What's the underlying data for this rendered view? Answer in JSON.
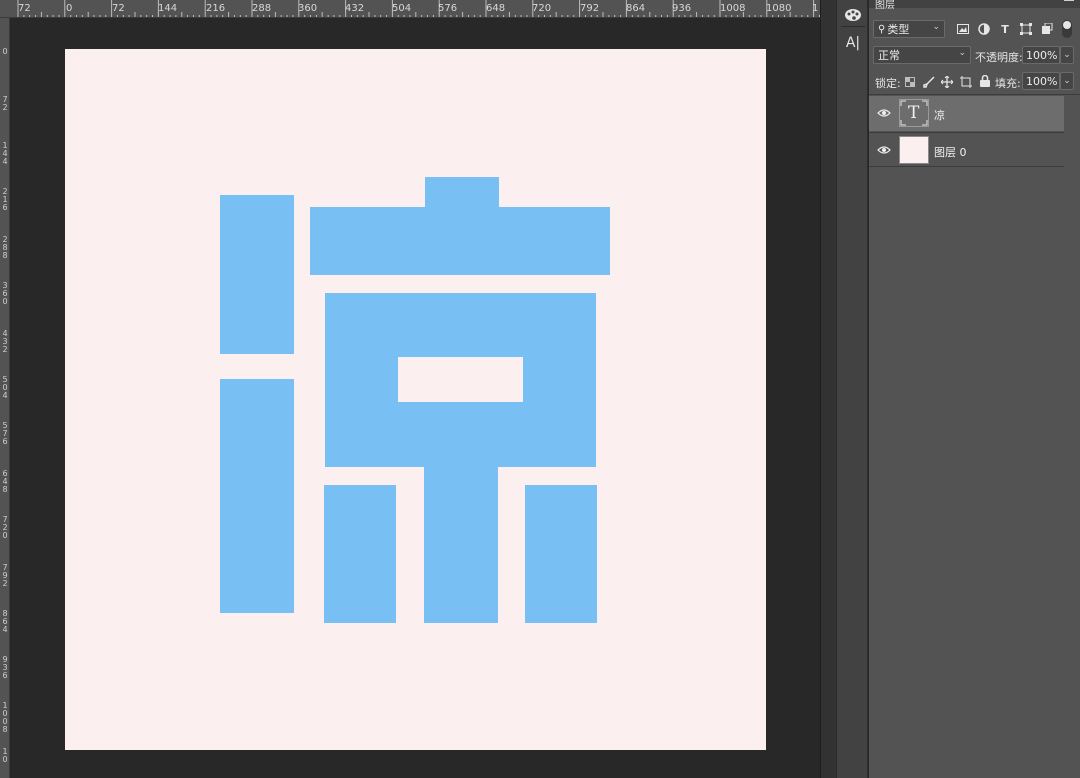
{
  "ruler": {
    "top_labels": [
      "72",
      "0",
      "72",
      "144",
      "216",
      "288",
      "360",
      "432",
      "504",
      "576",
      "648",
      "720",
      "792",
      "864",
      "936",
      "1008",
      "1080",
      "1"
    ],
    "left_labels": [
      "0",
      "7 2",
      "1 4 4",
      "2 1 6",
      "2 8 8",
      "3 6 0",
      "4 3 2",
      "5 0 4",
      "5 7 6",
      "6 4 8",
      "7 2 0",
      "7 9 2",
      "8 6 4",
      "9 3 6",
      "1 0 0 8",
      "1 0"
    ]
  },
  "colors": {
    "glyph": "#78bff3",
    "document_bg": "#fcefef",
    "workspace_bg": "#282828",
    "panel_bg": "#535353"
  },
  "tools": {
    "palette_icon": "color-palette-icon",
    "character_icon": "character-panel-icon",
    "character_glyph": "A|"
  },
  "panel": {
    "tab_label": "图层",
    "filter": {
      "value": "类型"
    },
    "filter_icons": [
      "image-filter-icon",
      "adjustment-filter-icon",
      "type-filter-icon",
      "shape-filter-icon",
      "smart-object-filter-icon"
    ],
    "blend_mode": "正常",
    "opacity_label": "不透明度:",
    "opacity_value": "100%",
    "lock_label": "锁定:",
    "fill_label": "填充:",
    "fill_value": "100%",
    "type_glyph": "T"
  },
  "layers": [
    {
      "name": "凉",
      "kind": "text",
      "active": true
    },
    {
      "name": "图层 0",
      "kind": "pixel",
      "active": false
    }
  ]
}
